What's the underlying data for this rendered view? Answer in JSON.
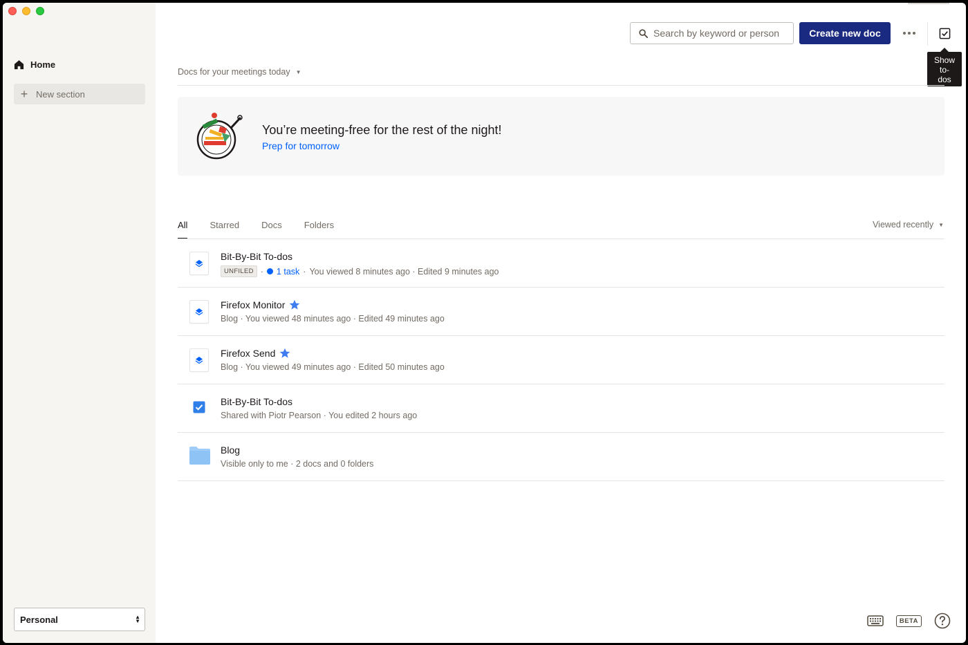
{
  "sidebar": {
    "home_label": "Home",
    "new_section_label": "New section",
    "workspace": "Personal"
  },
  "header": {
    "search_placeholder": "Search by keyword or person",
    "create_label": "Create new doc",
    "tooltip_lines": [
      "Show",
      "to-",
      "dos"
    ]
  },
  "meetings": {
    "dropdown_label": "Docs for your meetings today",
    "title": "You’re meeting-free for the rest of the night!",
    "link": "Prep for tomorrow"
  },
  "tabs": [
    "All",
    "Starred",
    "Docs",
    "Folders"
  ],
  "active_tab": "All",
  "sort_label": "Viewed recently",
  "docs": [
    {
      "title": "Bit-By-Bit To-dos",
      "icon": "paper-doc-icon",
      "starred": false,
      "badge": "UNFILED",
      "task": "1 task",
      "meta": "You viewed 8 minutes ago · Edited 9 minutes ago"
    },
    {
      "title": "Firefox Monitor",
      "icon": "paper-doc-icon",
      "starred": true,
      "meta": "Blog · You viewed 48 minutes ago · Edited 49 minutes ago"
    },
    {
      "title": "Firefox Send",
      "icon": "paper-doc-icon",
      "starred": true,
      "meta": "Blog · You viewed 49 minutes ago · Edited 50 minutes ago"
    },
    {
      "title": "Bit-By-Bit To-dos",
      "icon": "checkbox-icon",
      "starred": false,
      "meta": "Shared with Piotr Pearson · You edited 2 hours ago"
    },
    {
      "title": "Blog",
      "icon": "folder-icon",
      "starred": false,
      "meta": "Visible only to me · 2 docs and 0 folders"
    }
  ],
  "footer": {
    "beta_label": "BETA"
  },
  "colors": {
    "accent": "#0061fe",
    "primary_button": "#1a2a80",
    "sidebar_bg": "#f7f5f2",
    "folder": "#a0cdf8"
  }
}
